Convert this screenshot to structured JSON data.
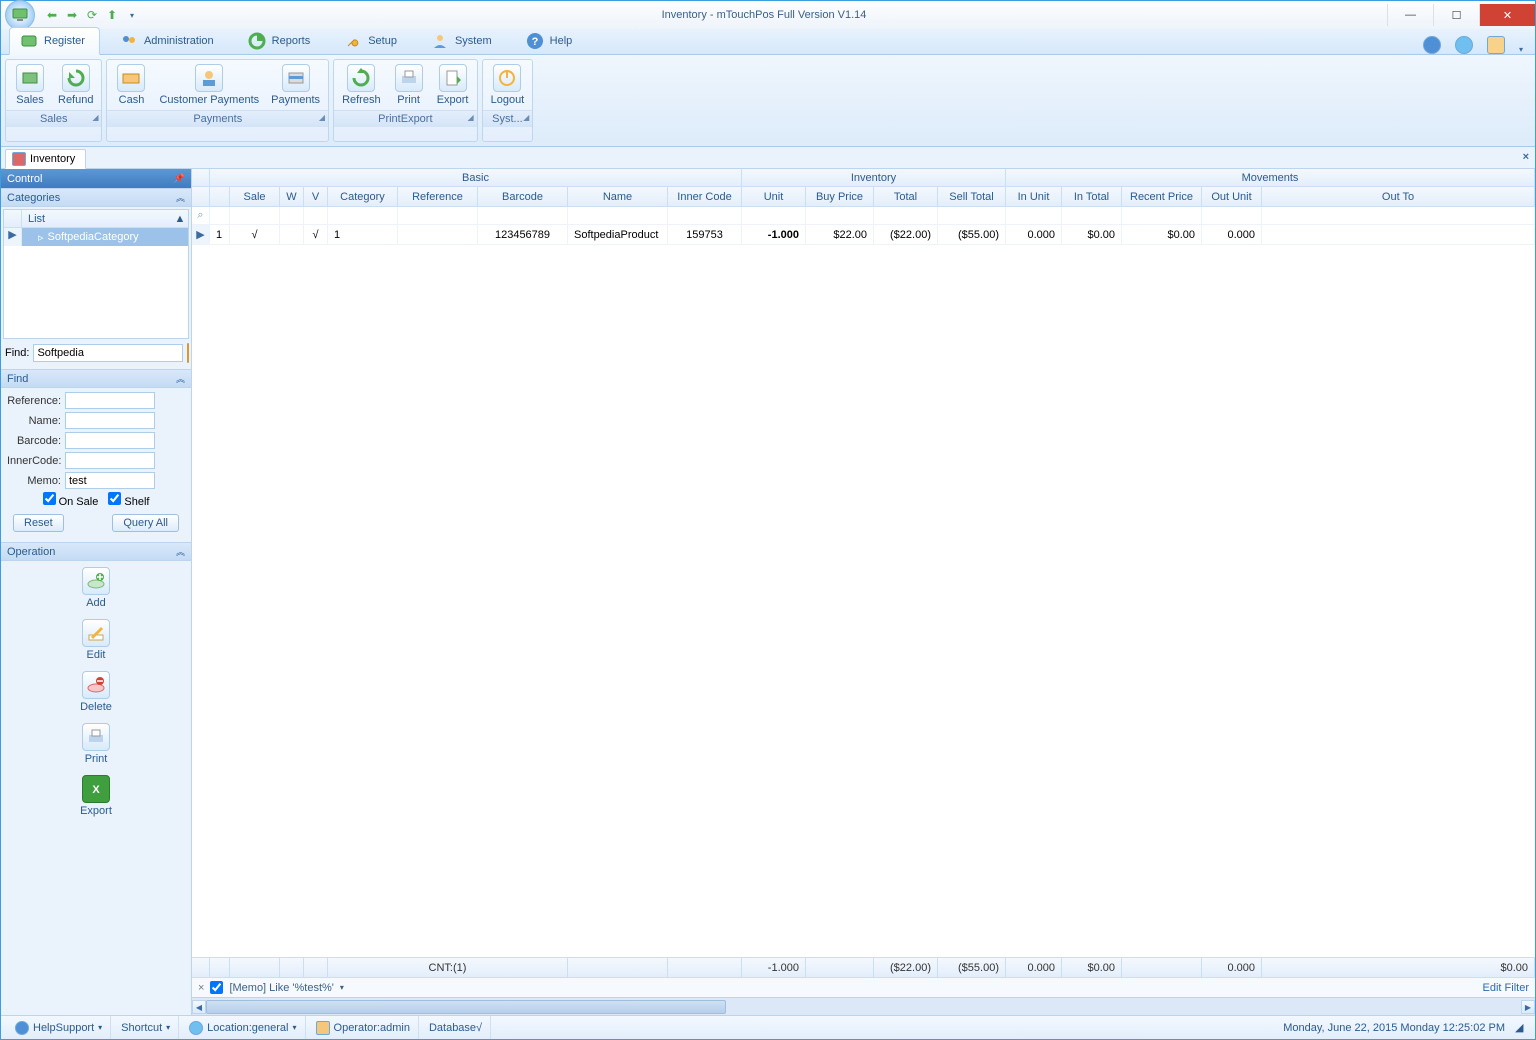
{
  "window": {
    "title": "Inventory - mTouchPos Full Version V1.14"
  },
  "ribbon_tabs": {
    "register": "Register",
    "administration": "Administration",
    "reports": "Reports",
    "setup": "Setup",
    "system": "System",
    "help": "Help"
  },
  "ribbon": {
    "sales_group": "Sales",
    "payments_group": "Payments",
    "printexport_group": "PrintExport",
    "system_group": "Syst...",
    "sales": "Sales",
    "refund": "Refund",
    "cash": "Cash",
    "customer_payments": "Customer Payments",
    "payments": "Payments",
    "refresh": "Refresh",
    "print": "Print",
    "export": "Export",
    "logout": "Logout"
  },
  "doc_tab": "Inventory",
  "sidebar": {
    "control": "Control",
    "categories": "Categories",
    "list_header": "List",
    "category_item": "SoftpediaCategory",
    "find_label": "Find:",
    "find_value": "Softpedia",
    "find_panel": "Find",
    "reference": "Reference:",
    "name": "Name:",
    "barcode": "Barcode:",
    "innercode": "InnerCode:",
    "memo": "Memo:",
    "memo_value": "test",
    "on_sale": "On Sale",
    "shelf": "Shelf",
    "reset": "Reset",
    "query_all": "Query All",
    "operation": "Operation",
    "add": "Add",
    "edit": "Edit",
    "delete": "Delete",
    "printop": "Print",
    "exportop": "Export"
  },
  "grid": {
    "bands": {
      "basic": "Basic",
      "inventory": "Inventory",
      "movements": "Movements"
    },
    "cols": {
      "sale": "Sale",
      "w": "W",
      "v": "V",
      "category": "Category",
      "reference": "Reference",
      "barcode": "Barcode",
      "name": "Name",
      "inner": "Inner Code",
      "unit": "Unit",
      "buy": "Buy Price",
      "total": "Total",
      "sell": "Sell Total",
      "inunit": "In Unit",
      "intotal": "In Total",
      "recent": "Recent Price",
      "outunit": "Out Unit",
      "outtot": "Out To"
    },
    "row": {
      "no": "1",
      "sale": "√",
      "w": "",
      "v": "√",
      "category": "1",
      "reference": "",
      "barcode": "123456789",
      "name": "SoftpediaProduct",
      "inner": "159753",
      "unit": "-1.000",
      "buy": "$22.00",
      "total": "($22.00)",
      "sell": "($55.00)",
      "inunit": "0.000",
      "intotal": "$0.00",
      "recent": "$0.00",
      "outunit": "0.000",
      "outtot": ""
    },
    "footer": {
      "cnt": "CNT:(1)",
      "unit": "-1.000",
      "total": "($22.00)",
      "sell": "($55.00)",
      "inunit": "0.000",
      "intotal": "$0.00",
      "outunit": "0.000",
      "outtot": "$0.00"
    },
    "filter_text": "[Memo] Like '%test%'",
    "edit_filter": "Edit Filter"
  },
  "status": {
    "help": "HelpSupport",
    "shortcut": "Shortcut",
    "location": "Location:general",
    "operator": "Operator:admin",
    "database": "Database√",
    "datetime": "Monday, June 22, 2015 Monday 12:25:02 PM"
  }
}
